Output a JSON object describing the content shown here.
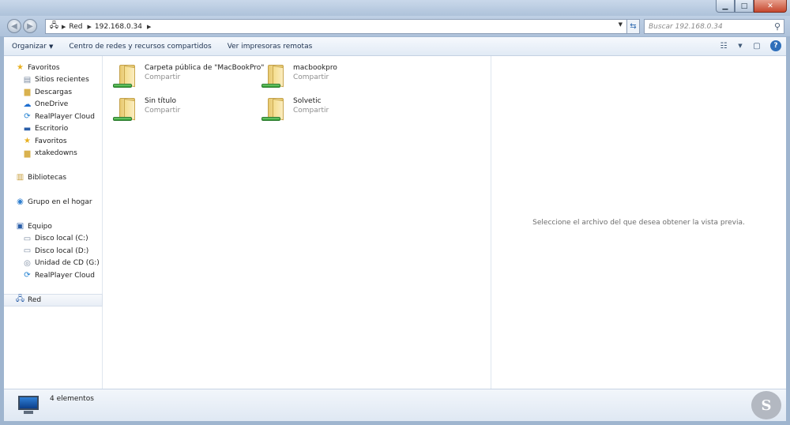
{
  "address": {
    "crumbs": [
      "Red",
      "192.168.0.34"
    ]
  },
  "search": {
    "placeholder": "Buscar 192.168.0.34"
  },
  "toolbar": {
    "organize": "Organizar",
    "network_center": "Centro de redes y recursos compartidos",
    "remote_printers": "Ver impresoras remotas"
  },
  "nav": {
    "favorites": {
      "label": "Favoritos",
      "items": [
        "Sitios recientes",
        "Descargas",
        "OneDrive",
        "RealPlayer Cloud",
        "Escritorio",
        "Favoritos",
        "xtakedowns"
      ]
    },
    "libraries": "Bibliotecas",
    "homegroup": "Grupo en el hogar",
    "computer": {
      "label": "Equipo",
      "items": [
        "Disco local (C:)",
        "Disco local (D:)",
        "Unidad de CD (G:)",
        "RealPlayer Cloud"
      ]
    },
    "network": "Red"
  },
  "folders": [
    {
      "name": "Carpeta pública de \"MacBookPro\"",
      "type": "Compartir"
    },
    {
      "name": "macbookpro",
      "type": "Compartir"
    },
    {
      "name": "Sin título",
      "type": "Compartir"
    },
    {
      "name": "Solvetic",
      "type": "Compartir"
    }
  ],
  "preview_message": "Seleccione el archivo del que desea obtener la vista previa.",
  "status": {
    "count": "4 elementos"
  },
  "colors": {
    "folder": "#f0d583",
    "share_pipe": "#2b9a2f",
    "accent": "#2f6fba"
  }
}
